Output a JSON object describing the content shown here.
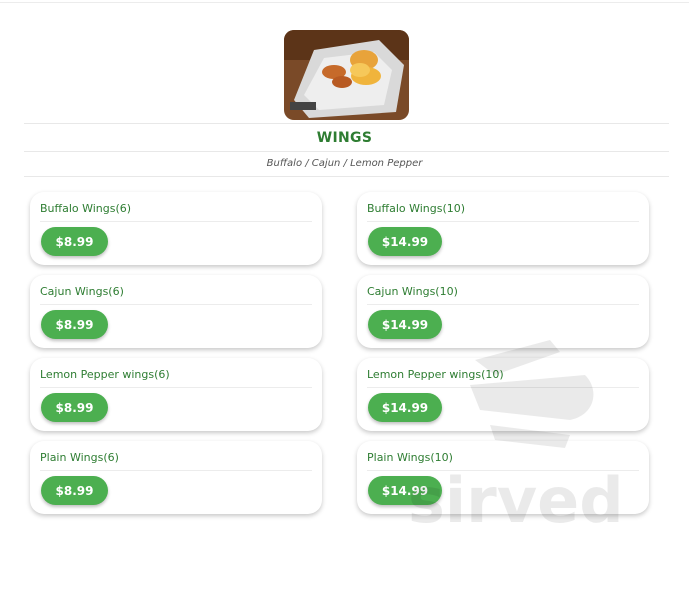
{
  "category": {
    "title": "WINGS",
    "subtitle": "Buffalo / Cajun / Lemon Pepper"
  },
  "items": [
    {
      "name": "Buffalo Wings(6)",
      "price": "$8.99"
    },
    {
      "name": "Buffalo Wings(10)",
      "price": "$14.99"
    },
    {
      "name": "Cajun Wings(6)",
      "price": "$8.99"
    },
    {
      "name": "Cajun Wings(10)",
      "price": "$14.99"
    },
    {
      "name": "Lemon Pepper wings(6)",
      "price": "$8.99"
    },
    {
      "name": "Lemon Pepper wings(10)",
      "price": "$14.99"
    },
    {
      "name": "Plain Wings(6)",
      "price": "$8.99"
    },
    {
      "name": "Plain Wings(10)",
      "price": "$14.99"
    }
  ],
  "watermark": {
    "text": "sirved"
  },
  "colors": {
    "accent": "#4caf50",
    "title": "#2e7d32"
  }
}
